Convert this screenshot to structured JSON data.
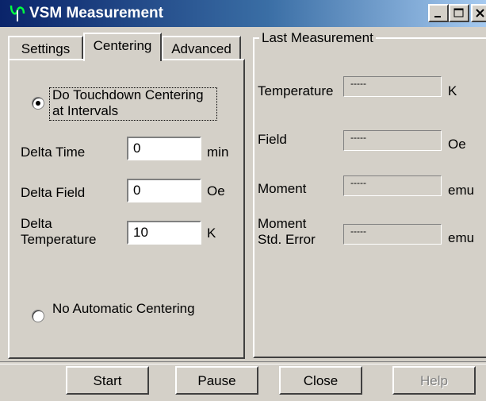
{
  "window": {
    "title": "VSM Measurement",
    "app_icon": "vsm-app-icon"
  },
  "title_buttons": [
    "minimize",
    "maximize",
    "close"
  ],
  "tabs": [
    {
      "label": "Settings"
    },
    {
      "label": "Centering",
      "selected": true
    },
    {
      "label": "Advanced"
    }
  ],
  "centering": {
    "radio_touchdown": {
      "line1": "Do Touchdown Centering",
      "line2": "at Intervals",
      "selected": true
    },
    "delta_time": {
      "label": "Delta Time",
      "value": "0",
      "unit": "min"
    },
    "delta_field": {
      "label": "Delta Field",
      "value": "0",
      "unit": "Oe"
    },
    "delta_temp": {
      "label1": "Delta",
      "label2": "Temperature",
      "value": "10",
      "unit": "K"
    },
    "radio_none": {
      "label": "No Automatic Centering",
      "selected": false
    }
  },
  "last_measurement": {
    "title": "Last Measurement",
    "temperature": {
      "label": "Temperature",
      "value": "-----",
      "unit": "K"
    },
    "field": {
      "label": "Field",
      "value": "-----",
      "unit": "Oe"
    },
    "moment": {
      "label": "Moment",
      "value": "-----",
      "unit": "emu"
    },
    "moment_err": {
      "label1": "Moment",
      "label2": "Std. Error",
      "value": "-----",
      "unit": "emu"
    }
  },
  "buttons": {
    "start": "Start",
    "pause": "Pause",
    "close": "Close",
    "help": "Help"
  },
  "colors": {
    "face": "#d4d0c8",
    "title_start": "#0a246a",
    "title_end": "#a6caf0"
  }
}
